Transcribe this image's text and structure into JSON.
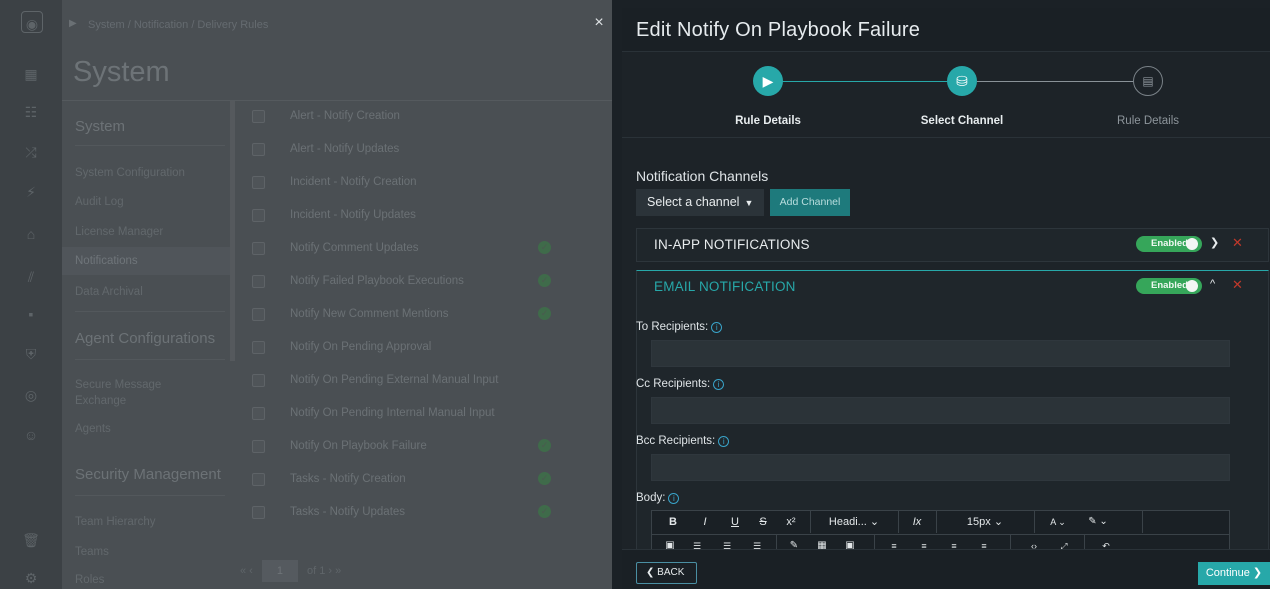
{
  "background": {
    "breadcrumb": "System / Notification / Delivery Rules",
    "page_title": "System",
    "nav": {
      "section_system": "System",
      "items_system": [
        "System Configuration",
        "Audit Log",
        "License Manager",
        "Notifications",
        "Data Archival"
      ],
      "section_agent": "Agent Configurations",
      "items_agent": [
        "Secure Message Exchange",
        "Agents"
      ],
      "section_security": "Security Management",
      "items_security": [
        "Team Hierarchy",
        "Teams",
        "Roles"
      ]
    },
    "rules": [
      {
        "label": "Alert - Notify Creation",
        "enabled": false
      },
      {
        "label": "Alert - Notify Updates",
        "enabled": false
      },
      {
        "label": "Incident - Notify Creation",
        "enabled": false
      },
      {
        "label": "Incident - Notify Updates",
        "enabled": false
      },
      {
        "label": "Notify Comment Updates",
        "enabled": true
      },
      {
        "label": "Notify Failed Playbook Executions",
        "enabled": true
      },
      {
        "label": "Notify New Comment Mentions",
        "enabled": true
      },
      {
        "label": "Notify On Pending Approval",
        "enabled": false
      },
      {
        "label": "Notify On Pending External Manual Input",
        "enabled": false
      },
      {
        "label": "Notify On Pending Internal Manual Input",
        "enabled": false
      },
      {
        "label": "Notify On Playbook Failure",
        "enabled": true
      },
      {
        "label": "Tasks - Notify Creation",
        "enabled": true
      },
      {
        "label": "Tasks - Notify Updates",
        "enabled": true
      }
    ],
    "pager": {
      "prev": "« ‹",
      "page": "1",
      "of": "of 1",
      "next": "› »"
    }
  },
  "close_icon": "×",
  "drawer": {
    "title": "Edit Notify On Playbook Failure",
    "steps": [
      {
        "label": "Rule Details",
        "state": "done"
      },
      {
        "label": "Select Channel",
        "state": "current"
      },
      {
        "label": "Rule Details",
        "state": "todo"
      }
    ],
    "section_title": "Notification Channels",
    "select_channel_label": "Select a channel",
    "add_channel_label": "Add Channel",
    "panels": [
      {
        "name": "IN-APP NOTIFICATIONS",
        "toggle": "Enabled",
        "expanded": false
      },
      {
        "name": "EMAIL NOTIFICATION",
        "toggle": "Enabled",
        "expanded": true
      }
    ],
    "fields": {
      "to_label": "To Recipients:",
      "cc_label": "Cc Recipients:",
      "bcc_label": "Bcc Recipients:",
      "body_label": "Body:"
    },
    "editor": {
      "bold": "B",
      "italic": "I",
      "underline": "U",
      "strike": "S",
      "superscript": "x²",
      "heading": "Headi... ⌄",
      "clear": "Ix",
      "size": "15px ⌄",
      "font_color": "A ⌄",
      "bg_color": "✎ ⌄"
    },
    "back_label": "BACK",
    "continue_label": "Continue"
  },
  "colors": {
    "accent": "#27a8a9",
    "enabled_toggle": "#36a65a",
    "remove": "#c0392b",
    "info": "#39a3c9"
  }
}
